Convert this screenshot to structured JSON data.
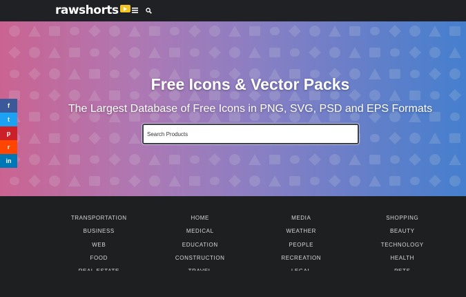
{
  "header": {
    "logo_text": "rawshorts",
    "icons": [
      "menu-icon",
      "search-icon"
    ]
  },
  "hero": {
    "title": "Free Icons & Vector Packs",
    "subtitle": "The Largest Database of Free Icons in PNG, SVG, PSD and EPS Formats",
    "search_placeholder": "Search Products",
    "gradient_colors": [
      "#e56fa0",
      "#c487c7",
      "#9c8fd9",
      "#6e8fe0",
      "#4d8fe5"
    ]
  },
  "share_bar": [
    {
      "name": "facebook",
      "glyph": "f",
      "color": "#3b5998"
    },
    {
      "name": "twitter",
      "glyph": "t",
      "color": "#1da1f2"
    },
    {
      "name": "pinterest",
      "glyph": "p",
      "color": "#cb2027"
    },
    {
      "name": "reddit",
      "glyph": "r",
      "color": "#ff4500"
    },
    {
      "name": "linkedin",
      "glyph": "in",
      "color": "#0077b5"
    }
  ],
  "categories": {
    "columns": [
      [
        "TRANSPORTATION",
        "BUSINESS",
        "WEB",
        "FOOD",
        "REAL ESTATE"
      ],
      [
        "HOME",
        "MEDICAL",
        "EDUCATION",
        "CONSTRUCTION",
        "TRAVEL"
      ],
      [
        "MEDIA",
        "WEATHER",
        "PEOPLE",
        "RECREATION",
        "LEGAL"
      ],
      [
        "SHOPPING",
        "BEAUTY",
        "TECHNOLOGY",
        "HEALTH",
        "PETS"
      ]
    ]
  }
}
